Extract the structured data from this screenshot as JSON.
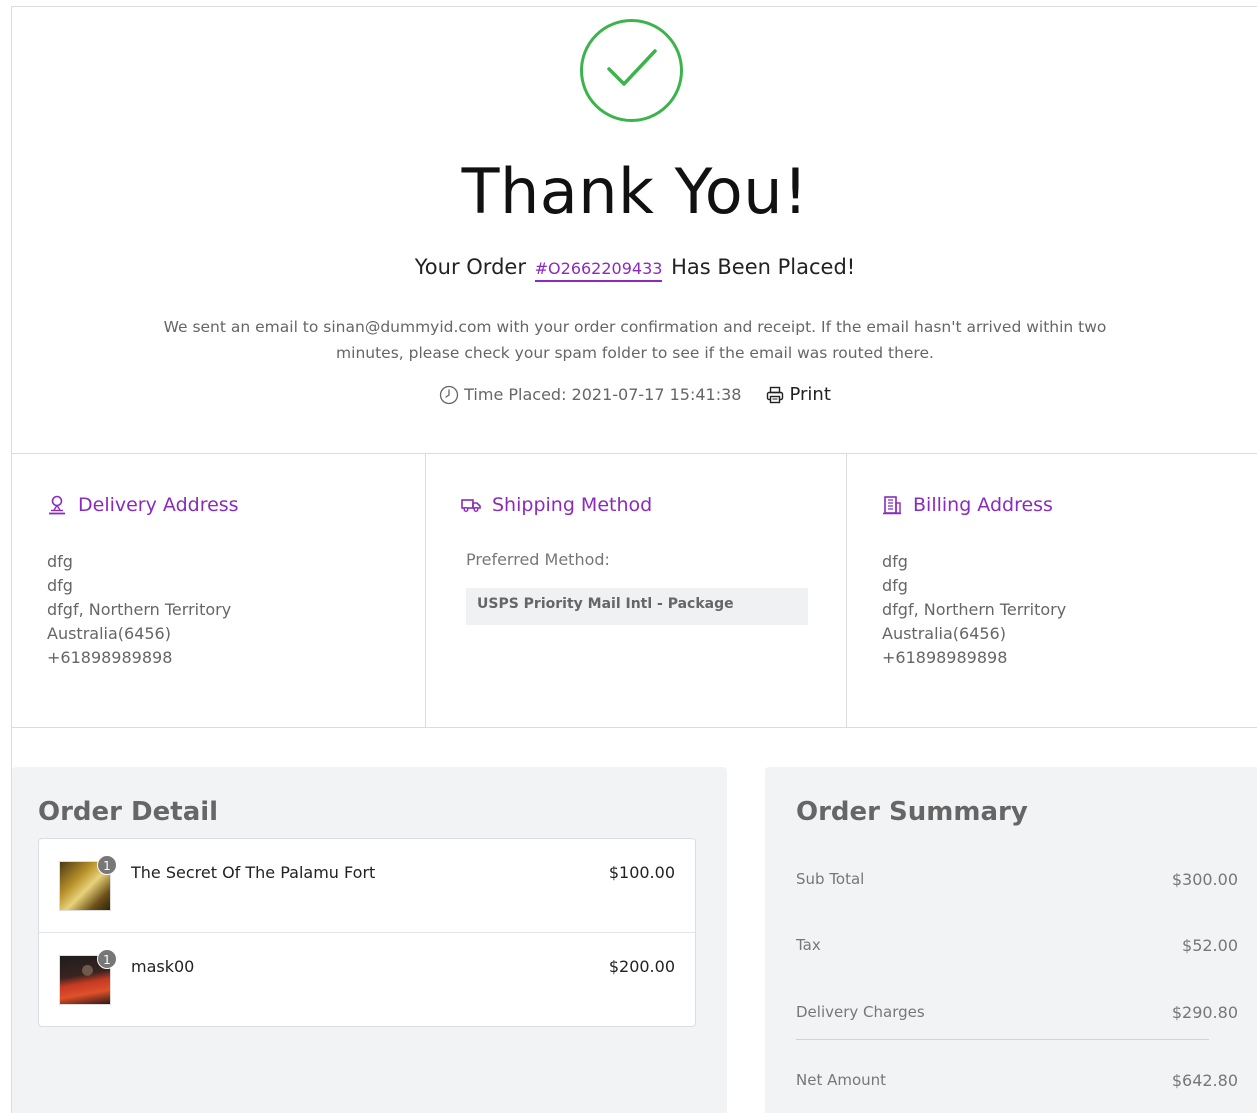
{
  "hero": {
    "title": "Thank You!",
    "order_prefix": "Your Order",
    "order_id": "#O2662209433",
    "order_suffix": "Has Been Placed!",
    "email_message": "We sent an email to sinan@dummyid.com with your order confirmation and receipt. If the email hasn't arrived within two minutes, please check your spam folder to see if the email was routed there.",
    "time_placed": "Time Placed: 2021-07-17 15:41:38",
    "print_label": "Print"
  },
  "delivery": {
    "title": "Delivery Address",
    "lines": [
      "dfg",
      "dfg",
      "dfgf, Northern Territory",
      "Australia(6456)",
      "+61898989898"
    ]
  },
  "shipping": {
    "title": "Shipping Method",
    "preferred_label": "Preferred Method:",
    "preferred_value": "USPS Priority Mail Intl - Package"
  },
  "billing": {
    "title": "Billing Address",
    "lines": [
      "dfg",
      "dfg",
      "dfgf, Northern Territory",
      "Australia(6456)",
      "+61898989898"
    ]
  },
  "order_detail": {
    "title": "Order Detail",
    "items": [
      {
        "name": "The Secret Of The Palamu Fort",
        "price": "$100.00",
        "qty": "1"
      },
      {
        "name": "mask00",
        "price": "$200.00",
        "qty": "1"
      }
    ]
  },
  "order_summary": {
    "title": "Order Summary",
    "rows": [
      {
        "label": "Sub Total",
        "value": "$300.00"
      },
      {
        "label": "Tax",
        "value": "$52.00"
      },
      {
        "label": "Delivery Charges",
        "value": "$290.80"
      },
      {
        "label": "Net Amount",
        "value": "$642.80"
      }
    ]
  },
  "colors": {
    "accent": "#8a2bbd",
    "success": "#3cb44b"
  },
  "icons": [
    "check-icon",
    "clock-icon",
    "printer-icon",
    "user-location-icon",
    "truck-icon",
    "building-icon"
  ]
}
